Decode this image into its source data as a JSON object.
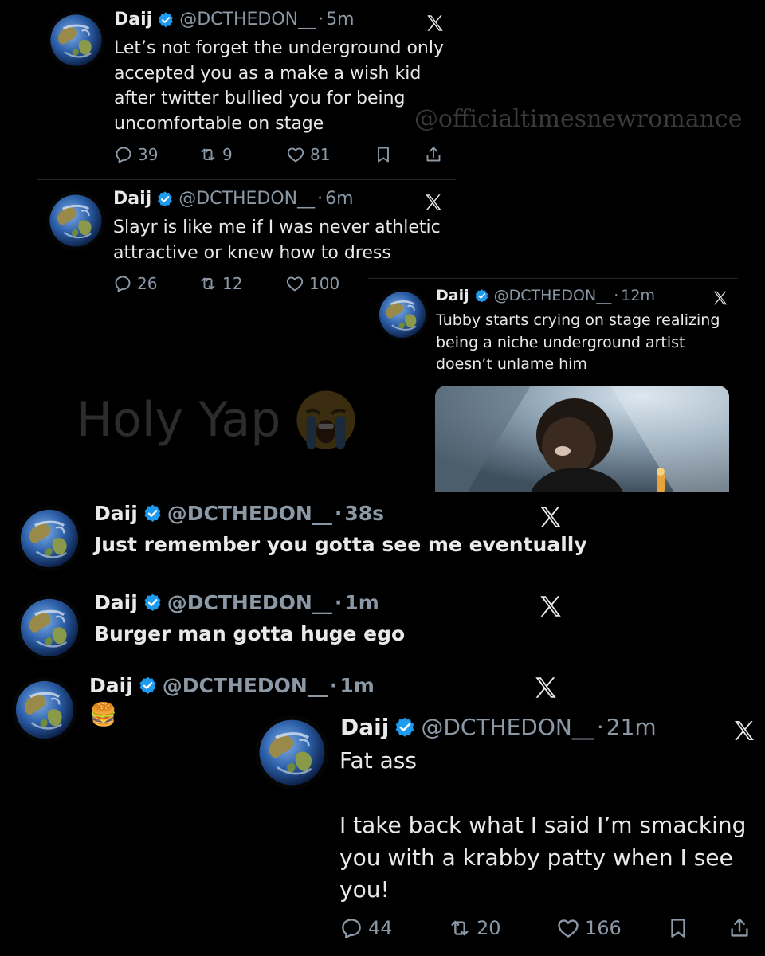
{
  "watermark": "@officialtimesnewromance",
  "overlay_text": "Holy Yap",
  "overlay_emoji": "loudly-crying-face-emoji",
  "colors": {
    "background": "#000000",
    "text": "#e7e9ea",
    "secondary": "#8b98a5",
    "verified": "#1d9bf0"
  },
  "tweets": [
    {
      "name": "Daij",
      "handle": "@DCTHEDON__",
      "dot": "·",
      "time": "5m",
      "text": "Let’s not forget the underground only\naccepted you as a make a wish kid\nafter twitter bullied you for being\nuncomfortable on stage",
      "replies": "39",
      "reposts": "9",
      "likes": "81"
    },
    {
      "name": "Daij",
      "handle": "@DCTHEDON__",
      "dot": "·",
      "time": "6m",
      "text": "Slayr is like me if I was never athletic\nattractive or knew how to dress",
      "replies": "26",
      "reposts": "12",
      "likes": "100"
    },
    {
      "name": "Daij",
      "handle": "@DCTHEDON__",
      "dot": "·",
      "time": "12m",
      "text": "Tubby starts crying on stage realizing\nbeing a niche underground artist\ndoesn’t unlame him"
    },
    {
      "name": "Daij",
      "handle": "@DCTHEDON__",
      "dot": "·",
      "time": "38s",
      "text": "Just remember you gotta see me eventually"
    },
    {
      "name": "Daij",
      "handle": "@DCTHEDON__",
      "dot": "·",
      "time": "1m",
      "text": "Burger man gotta huge ego"
    },
    {
      "name": "Daij",
      "handle": "@DCTHEDON__",
      "dot": "·",
      "time": "1m",
      "text": "🍔"
    },
    {
      "name": "Daij",
      "handle": "@DCTHEDON__",
      "dot": "·",
      "time": "21m",
      "text": "Fat ass\n\nI take back what I said I’m smacking\nyou with a krabby patty when I see\nyou!",
      "replies": "44",
      "reposts": "20",
      "likes": "166"
    }
  ]
}
